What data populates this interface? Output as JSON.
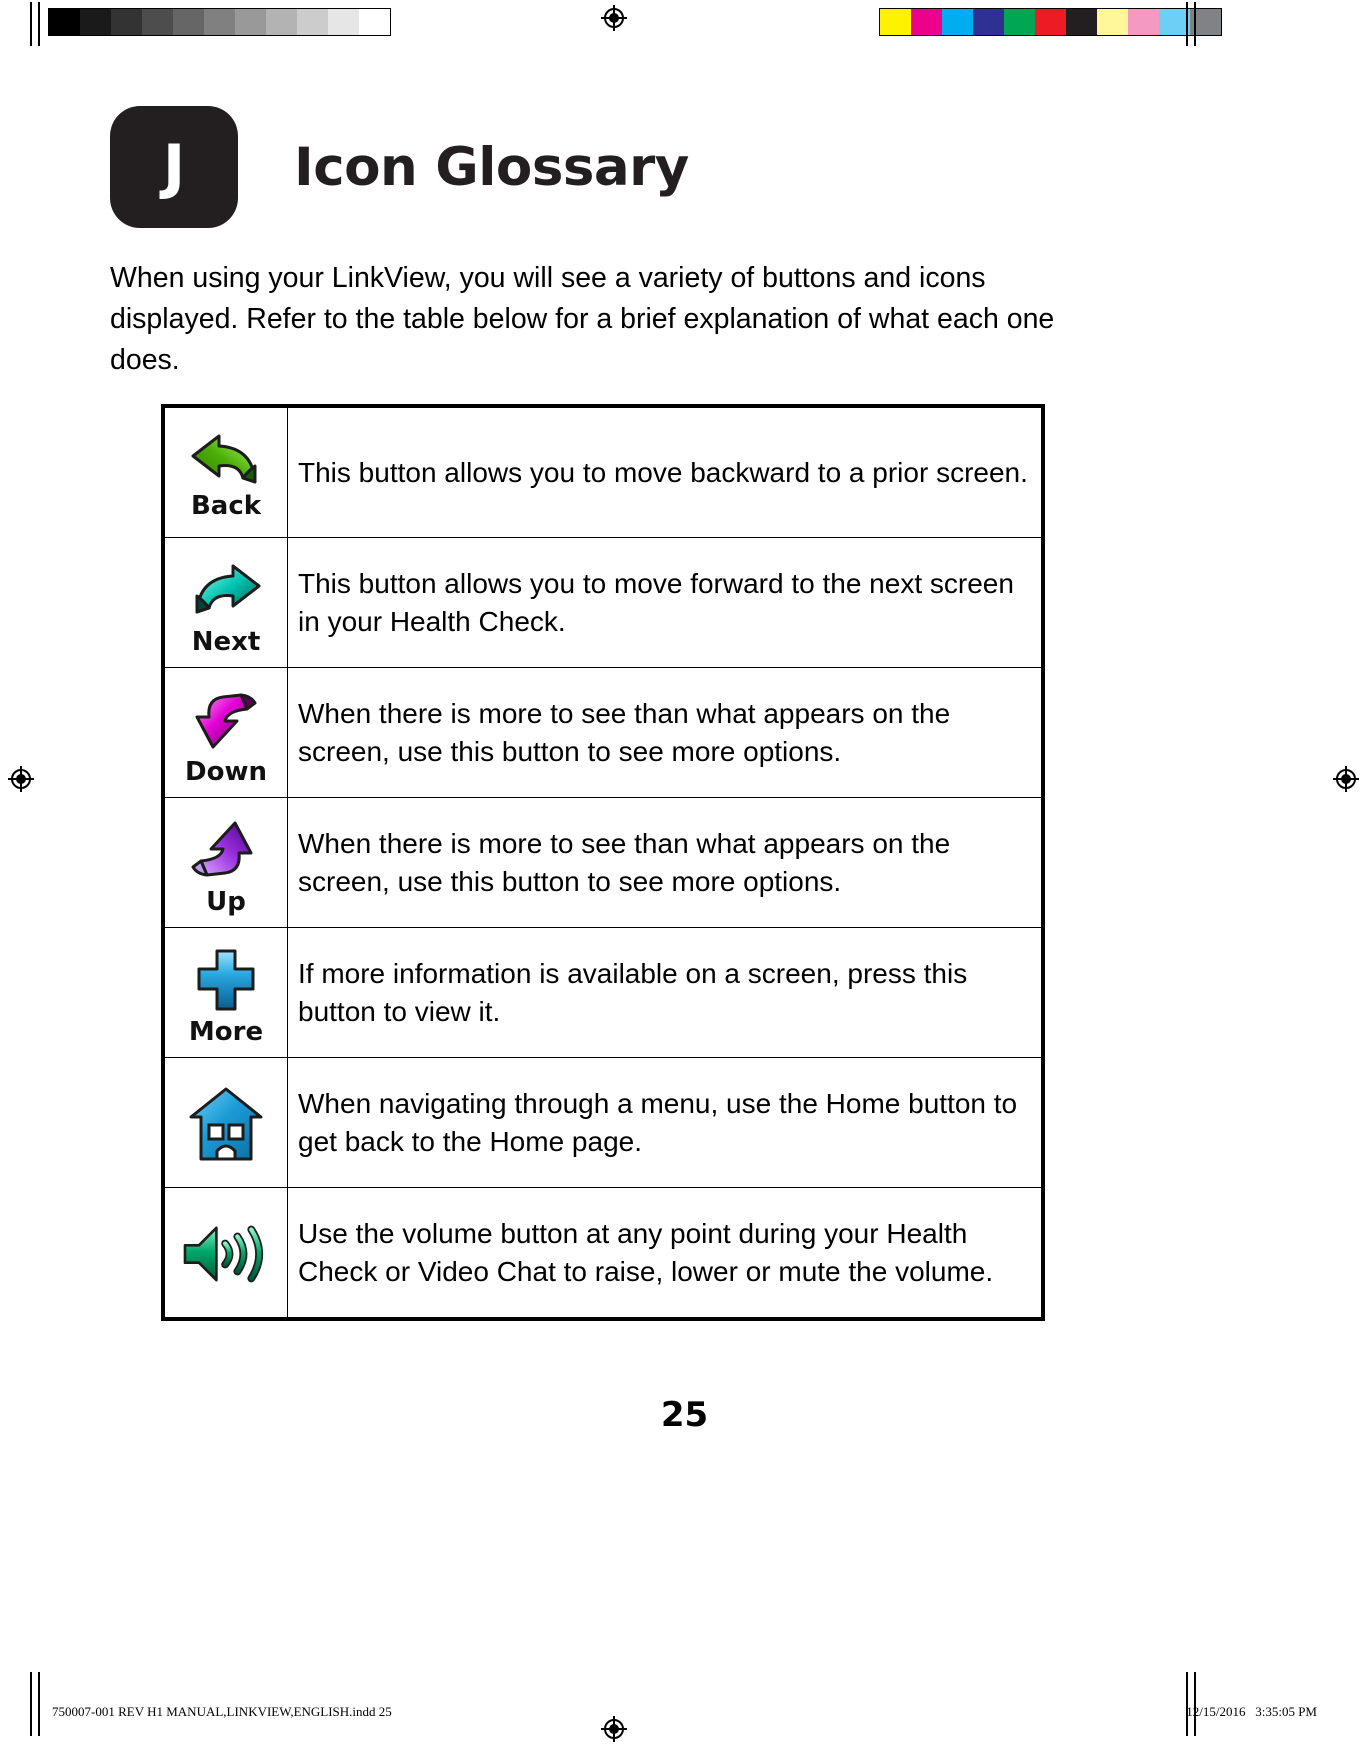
{
  "document": {
    "chapter_letter": "J",
    "title": "Icon Glossary",
    "intro": "When using your LinkView, you will see a variety of buttons and icons displayed. Refer to the table below for a brief explanation of what each one does.",
    "page_number": "25"
  },
  "calibration": {
    "grayscale_swatches": [
      "#000000",
      "#1a1a1a",
      "#333333",
      "#4d4d4d",
      "#666666",
      "#808080",
      "#999999",
      "#b3b3b3",
      "#cccccc",
      "#e6e6e6",
      "#ffffff"
    ],
    "color_swatches": [
      "#fff200",
      "#ec008c",
      "#00aeef",
      "#2e3192",
      "#00a651",
      "#ed1c24",
      "#231f20",
      "#fff79a",
      "#f49ac1",
      "#6dcff6",
      "#808285"
    ]
  },
  "glossary": {
    "rows": [
      {
        "icon_name": "back-arrow-icon",
        "icon_label": "Back",
        "icon_color": "#4caf09",
        "description": "This button allows you to move backward to a prior screen."
      },
      {
        "icon_name": "next-arrow-icon",
        "icon_label": "Next",
        "icon_color": "#00c4b0",
        "description": "This button allows you to move forward to the next screen in your Health Check."
      },
      {
        "icon_name": "down-arrow-icon",
        "icon_label": "Down",
        "icon_color": "#e300d6",
        "description": "When there is more to see than what appears on the screen, use this button to see more options."
      },
      {
        "icon_name": "up-arrow-icon",
        "icon_label": "Up",
        "icon_color": "#9b30e0",
        "description": "When there is more to see than what appears on the screen, use this button to see more options."
      },
      {
        "icon_name": "more-plus-icon",
        "icon_label": "More",
        "icon_color": "#29a8e0",
        "description": "If more information is available on a screen, press this button to view it."
      },
      {
        "icon_name": "home-house-icon",
        "icon_label": "",
        "icon_color": "#1b9ad6",
        "description": "When navigating through a menu, use the Home button to get back to the Home page."
      },
      {
        "icon_name": "volume-speaker-icon",
        "icon_label": "",
        "icon_color": "#00a86b",
        "description": "Use the volume button at any point during your Health Check or Video Chat to raise, lower or mute the volume."
      }
    ]
  },
  "footer": {
    "file_info": "750007-001 REV H1 MANUAL,LINKVIEW,ENGLISH.indd   25",
    "timestamp": "12/15/2016   3:35:05 PM"
  }
}
